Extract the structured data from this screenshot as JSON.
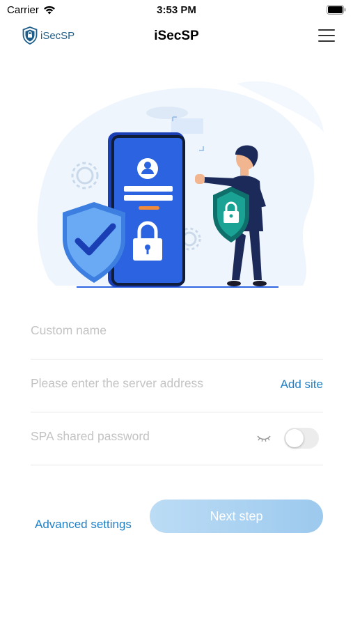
{
  "status_bar": {
    "carrier": "Carrier",
    "time": "3:53 PM"
  },
  "navbar": {
    "brand": "iSecSP",
    "title": "iSecSP",
    "icons": [
      "shield-logo-icon",
      "hamburger-menu-icon"
    ]
  },
  "illustration": {
    "description_icons": [
      "phone-login-illustration",
      "shield-check-icon",
      "padlock-icon",
      "person-with-shield-icon",
      "gear-icon"
    ],
    "colors": {
      "phone": "#2b63e0",
      "shield_left": "#5aa0f2",
      "shield_right": "#1a8f86",
      "background_blob": "#eef5fd"
    }
  },
  "form": {
    "custom_name": {
      "placeholder": "Custom name",
      "value": ""
    },
    "server_address": {
      "placeholder": "Please enter the server address",
      "value": "",
      "action_label": "Add site"
    },
    "spa_password": {
      "placeholder": "SPA shared password",
      "value": "",
      "toggle_on": false
    }
  },
  "actions": {
    "advanced_settings": "Advanced settings",
    "next_step": "Next step"
  },
  "colors": {
    "accent": "#1f7fc5",
    "button_gradient_start": "#bcdcf5",
    "button_gradient_end": "#9cc9ee",
    "divider": "#e6e6e6"
  }
}
